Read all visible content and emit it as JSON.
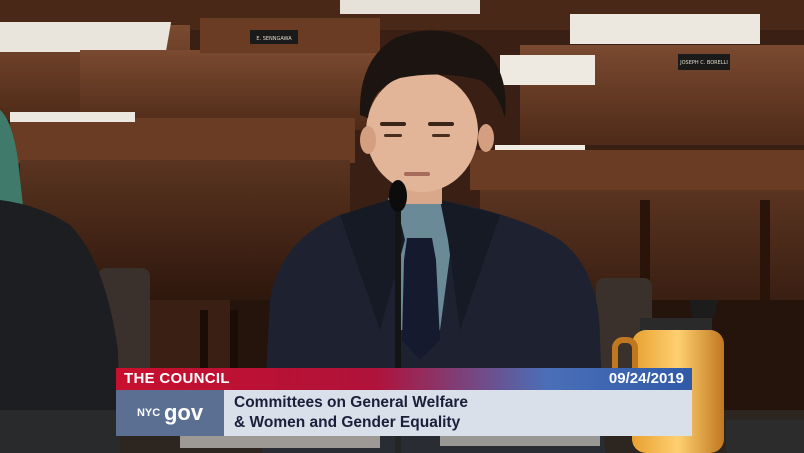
{
  "lower_third": {
    "org": "THE COUNCIL",
    "date": "09/24/2019",
    "logo_top": "NYC",
    "logo_gov": "gov",
    "title_line1": "Committees on General Welfare",
    "title_line2": "& Women and Gender Equality"
  },
  "nameplates": {
    "left": "E. SENNGAWA",
    "right": "JOSEPH C. BORELLI"
  },
  "colors": {
    "banner_red": "#c8102e",
    "banner_blue": "#2f5aa8",
    "logo_bg": "#5a6f92",
    "title_bg": "#d9e0ea",
    "title_text": "#1a1f3a"
  }
}
